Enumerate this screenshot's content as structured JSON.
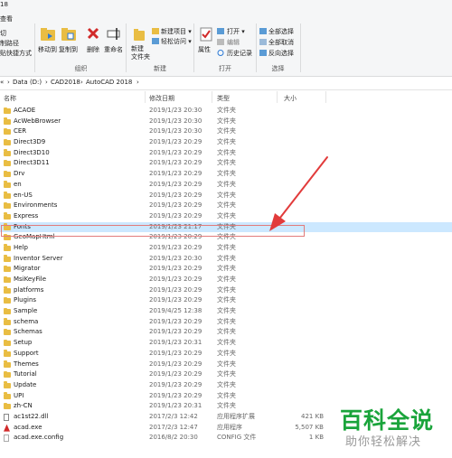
{
  "window": {
    "title_fragment": "18",
    "menu_tab": "查看"
  },
  "ribbon": {
    "clipboard": {
      "items": [
        "切",
        "制路径",
        "贴快捷方式"
      ],
      "label": ""
    },
    "organize": {
      "move_to": "移动到",
      "copy_to": "复制到",
      "delete": "删除",
      "rename": "重命名",
      "label": "组织"
    },
    "new": {
      "new_folder": "新建\n文件夹",
      "new_item": "新建项目 ▾",
      "easy_access": "轻松访问 ▾",
      "label": "新建"
    },
    "open": {
      "properties": "属性",
      "open": "打开 ▾",
      "edit": "编辑",
      "history": "历史记录",
      "label": "打开"
    },
    "select": {
      "select_all": "全部选择",
      "select_none": "全部取消",
      "invert": "反向选择",
      "label": "选择"
    }
  },
  "address": {
    "crumbs": [
      "Data (D:)",
      "CAD2018",
      "AutoCAD 2018"
    ],
    "separator": "›",
    "parent_arrow": "«"
  },
  "columns": {
    "name": "名称",
    "date": "修改日期",
    "type": "类型",
    "size": "大小"
  },
  "files": [
    {
      "name": "ACAOE",
      "date": "2019/1/23 20:30",
      "type": "文件夹",
      "size": "",
      "kind": "folder"
    },
    {
      "name": "AcWebBrowser",
      "date": "2019/1/23 20:30",
      "type": "文件夹",
      "size": "",
      "kind": "folder"
    },
    {
      "name": "CER",
      "date": "2019/1/23 20:30",
      "type": "文件夹",
      "size": "",
      "kind": "folder"
    },
    {
      "name": "Direct3D9",
      "date": "2019/1/23 20:29",
      "type": "文件夹",
      "size": "",
      "kind": "folder"
    },
    {
      "name": "Direct3D10",
      "date": "2019/1/23 20:29",
      "type": "文件夹",
      "size": "",
      "kind": "folder"
    },
    {
      "name": "Direct3D11",
      "date": "2019/1/23 20:29",
      "type": "文件夹",
      "size": "",
      "kind": "folder"
    },
    {
      "name": "Drv",
      "date": "2019/1/23 20:29",
      "type": "文件夹",
      "size": "",
      "kind": "folder"
    },
    {
      "name": "en",
      "date": "2019/1/23 20:29",
      "type": "文件夹",
      "size": "",
      "kind": "folder"
    },
    {
      "name": "en-US",
      "date": "2019/1/23 20:29",
      "type": "文件夹",
      "size": "",
      "kind": "folder"
    },
    {
      "name": "Environments",
      "date": "2019/1/23 20:29",
      "type": "文件夹",
      "size": "",
      "kind": "folder"
    },
    {
      "name": "Express",
      "date": "2019/1/23 20:29",
      "type": "文件夹",
      "size": "",
      "kind": "folder"
    },
    {
      "name": "Fonts",
      "date": "2019/1/23 21:17",
      "type": "文件夹",
      "size": "",
      "kind": "folder",
      "selected": true
    },
    {
      "name": "GeoMapHtml",
      "date": "2019/1/23 20:29",
      "type": "文件夹",
      "size": "",
      "kind": "folder"
    },
    {
      "name": "Help",
      "date": "2019/1/23 20:29",
      "type": "文件夹",
      "size": "",
      "kind": "folder"
    },
    {
      "name": "Inventor Server",
      "date": "2019/1/23 20:30",
      "type": "文件夹",
      "size": "",
      "kind": "folder"
    },
    {
      "name": "Migrator",
      "date": "2019/1/23 20:29",
      "type": "文件夹",
      "size": "",
      "kind": "folder"
    },
    {
      "name": "MsiKeyFile",
      "date": "2019/1/23 20:29",
      "type": "文件夹",
      "size": "",
      "kind": "folder"
    },
    {
      "name": "platforms",
      "date": "2019/1/23 20:29",
      "type": "文件夹",
      "size": "",
      "kind": "folder"
    },
    {
      "name": "Plugins",
      "date": "2019/1/23 20:29",
      "type": "文件夹",
      "size": "",
      "kind": "folder"
    },
    {
      "name": "Sample",
      "date": "2019/4/25 12:38",
      "type": "文件夹",
      "size": "",
      "kind": "folder"
    },
    {
      "name": "schema",
      "date": "2019/1/23 20:29",
      "type": "文件夹",
      "size": "",
      "kind": "folder"
    },
    {
      "name": "Schemas",
      "date": "2019/1/23 20:29",
      "type": "文件夹",
      "size": "",
      "kind": "folder"
    },
    {
      "name": "Setup",
      "date": "2019/1/23 20:31",
      "type": "文件夹",
      "size": "",
      "kind": "folder"
    },
    {
      "name": "Support",
      "date": "2019/1/23 20:29",
      "type": "文件夹",
      "size": "",
      "kind": "folder"
    },
    {
      "name": "Themes",
      "date": "2019/1/23 20:29",
      "type": "文件夹",
      "size": "",
      "kind": "folder"
    },
    {
      "name": "Tutorial",
      "date": "2019/1/23 20:29",
      "type": "文件夹",
      "size": "",
      "kind": "folder"
    },
    {
      "name": "Update",
      "date": "2019/1/23 20:29",
      "type": "文件夹",
      "size": "",
      "kind": "folder"
    },
    {
      "name": "UPI",
      "date": "2019/1/23 20:29",
      "type": "文件夹",
      "size": "",
      "kind": "folder"
    },
    {
      "name": "zh-CN",
      "date": "2019/1/23 20:31",
      "type": "文件夹",
      "size": "",
      "kind": "folder"
    },
    {
      "name": "ac1st22.dll",
      "date": "2017/2/3 12:42",
      "type": "应用程序扩展",
      "size": "421 KB",
      "kind": "dll"
    },
    {
      "name": "acad.exe",
      "date": "2017/2/3 12:47",
      "type": "应用程序",
      "size": "5,507 KB",
      "kind": "exe"
    },
    {
      "name": "acad.exe.config",
      "date": "2016/8/2 20:30",
      "type": "CONFIG 文件",
      "size": "1 KB",
      "kind": "config"
    }
  ],
  "watermark": {
    "title": "百科全说",
    "subtitle": "助你轻松解决"
  },
  "colors": {
    "folder": "#e9bd43",
    "selection": "#cce8ff",
    "annotation": "#e23b3b",
    "watermark": "#1aa43b"
  }
}
